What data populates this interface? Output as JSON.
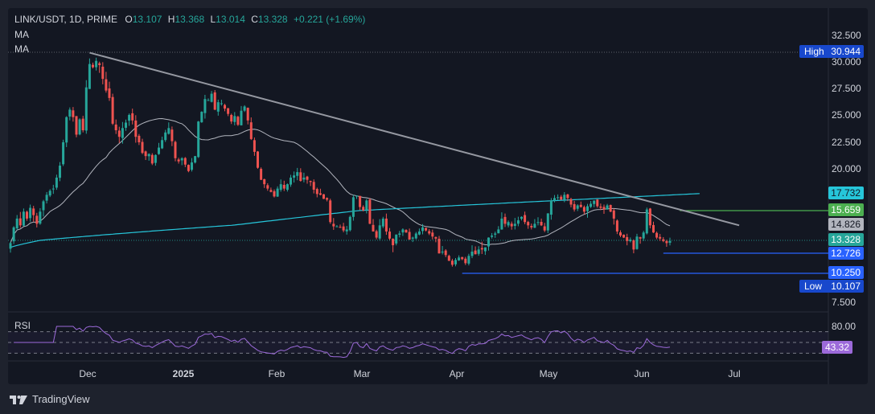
{
  "header": {
    "symbol": "LINK/USDT, 1D, PRIME",
    "open_label": "O",
    "open": "13.107",
    "high_label": "H",
    "high": "13.368",
    "low_label": "L",
    "low": "13.014",
    "close_label": "C",
    "close": "13.328",
    "change": "+0.221 (+1.69%)",
    "ma1": "MA",
    "ma2": "MA"
  },
  "rsi_label": "RSI",
  "footer": {
    "brand": "TradingView"
  },
  "colors": {
    "background": "#131722",
    "up": "#26a69a",
    "down": "#ef5350",
    "ma_short": "#b2b5be",
    "ma_long": "#26c6da",
    "trendline": "#9598a1",
    "resistance": "#4caf50",
    "support": "#2962ff",
    "rsi": "#9c6ada"
  },
  "chart_data": {
    "type": "candlestick",
    "xlabels": [
      "Dec",
      "2025",
      "Feb",
      "Mar",
      "Apr",
      "May",
      "Jun",
      "Jul"
    ],
    "yticks": [
      "32.500",
      "30.000",
      "27.500",
      "25.000",
      "22.500",
      "20.000",
      "7.500"
    ],
    "ylim": [
      7.5,
      32.5
    ],
    "price_tags": [
      {
        "label": "High",
        "value": "30.944"
      },
      {
        "value": "17.732"
      },
      {
        "value": "15.659"
      },
      {
        "value": "14.826"
      },
      {
        "value": "13.328"
      },
      {
        "value": "12.726"
      },
      {
        "value": "10.250"
      },
      {
        "label": "Low",
        "value": "10.107"
      }
    ],
    "trendline": {
      "from": [
        "2024-12-15",
        30.9
      ],
      "to": [
        "2025-06-30",
        14.8
      ]
    },
    "levels": [
      {
        "value": 15.659,
        "from": "2025-06-12"
      },
      {
        "value": 12.726,
        "from": "2025-06-07"
      },
      {
        "value": 10.25,
        "from": "2025-04-07"
      }
    ],
    "price_series": {
      "name": "LINK/USDT",
      "start_date": "2024-11-21",
      "close": [
        13.2,
        14.6,
        15.2,
        14.8,
        15.6,
        15.2,
        16.0,
        15.4,
        14.9,
        15.6,
        16.8,
        17.6,
        18.0,
        18.2,
        19.2,
        20.3,
        22.5,
        24.8,
        25.5,
        24.8,
        23.2,
        24.6,
        23.6,
        27.6,
        29.8,
        29.5,
        30.1,
        29.7,
        28.4,
        27.3,
        26.6,
        24.2,
        23.6,
        23.0,
        23.8,
        24.3,
        25.0,
        24.5,
        23.0,
        22.5,
        21.5,
        21.2,
        21.4,
        20.5,
        21.3,
        22.0,
        22.7,
        23.4,
        23.8,
        22.6,
        21.0,
        20.7,
        21.0,
        20.4,
        19.8,
        20.6,
        21.2,
        24.4,
        25.3,
        26.5,
        26.4,
        27.0,
        25.5,
        26.2,
        26.1,
        25.6,
        25.1,
        24.4,
        24.9,
        24.1,
        25.4,
        25.8,
        24.5,
        22.8,
        21.6,
        20.1,
        19.0,
        18.6,
        18.2,
        17.9,
        17.4,
        18.2,
        18.6,
        18.2,
        18.6,
        19.2,
        19.4,
        19.7,
        18.9,
        19.2,
        19.0,
        18.8,
        18.1,
        17.7,
        17.6,
        17.1,
        17.0,
        15.0,
        14.7,
        14.7,
        14.6,
        14.3,
        14.4,
        15.3,
        17.3,
        17.5,
        16.1,
        15.7,
        16.9,
        14.9,
        14.2,
        13.6,
        14.8,
        15.2,
        14.2,
        13.5,
        13.1,
        13.9,
        14.0,
        14.4,
        14.1,
        13.4,
        13.6,
        14.0,
        14.2,
        14.6,
        14.3,
        14.0,
        13.7,
        13.5,
        12.7,
        12.8,
        12.5,
        11.8,
        11.3,
        11.9,
        12.2,
        12.0,
        11.5,
        12.4,
        12.8,
        12.6,
        12.9,
        12.9,
        13.0,
        13.6,
        13.8,
        14.0,
        14.4,
        15.2,
        14.9,
        15.0,
        14.7,
        14.9,
        15.1,
        15.3,
        15.0,
        14.8,
        14.6,
        14.9,
        15.0,
        14.8,
        14.3,
        15.5,
        16.9,
        17.2,
        17.3,
        17.0,
        17.6,
        17.2,
        16.4,
        15.8,
        16.3,
        16.1,
        15.6,
        16.2,
        16.5,
        16.9,
        16.2,
        16.0,
        15.8,
        16.3,
        15.6,
        15.2,
        14.2,
        13.8,
        13.6,
        13.3,
        13.4,
        12.9,
        13.7,
        13.5,
        14.1,
        15.8,
        14.8,
        14.1,
        13.6,
        13.5,
        13.3,
        13.2,
        13.3
      ]
    },
    "rsi": {
      "yticks": [
        "80.00"
      ],
      "last_value": "43.32",
      "overbought": 70,
      "oversold": 30
    }
  }
}
